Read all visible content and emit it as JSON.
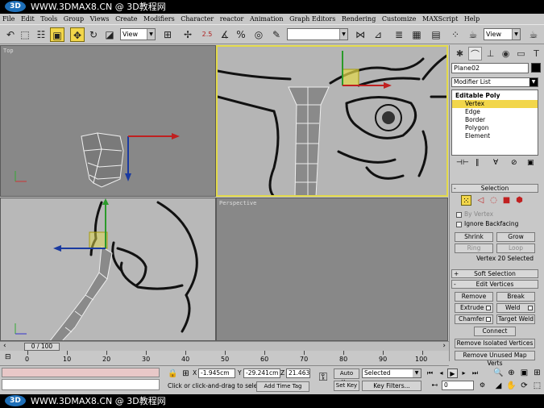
{
  "watermark": {
    "logo": "3D",
    "top_text": "WWW.3DMAX8.CN @ 3D教程网",
    "bottom_text": "WWW.3DMAX8.CN @ 3D教程网"
  },
  "menu": [
    "File",
    "Edit",
    "Tools",
    "Group",
    "Views",
    "Create",
    "Modifiers",
    "Character",
    "reactor",
    "Animation",
    "Graph Editors",
    "Rendering",
    "Customize",
    "MAXScript",
    "Help"
  ],
  "toolbar": {
    "ref_coord": "View",
    "named_sel": "",
    "view_right": "View",
    "snap_label": "2.5"
  },
  "viewports": {
    "top": "Top",
    "front": "",
    "left": "",
    "perspective": "Perspective"
  },
  "command_panel": {
    "object_name": "Plane02",
    "modifier_list": "Modifier List",
    "stack": [
      "Editable Poly",
      "Vertex",
      "Edge",
      "Border",
      "Polygon",
      "Element"
    ],
    "selection": {
      "title": "Selection",
      "by_vertex": "By Vertex",
      "ignore_backfacing": "Ignore Backfacing",
      "shrink": "Shrink",
      "grow": "Grow",
      "ring": "Ring",
      "loop": "Loop",
      "status": "Vertex 20 Selected"
    },
    "soft_selection": "Soft Selection",
    "edit_vertices": {
      "title": "Edit Vertices",
      "remove": "Remove",
      "break": "Break",
      "extrude": "Extrude",
      "weld": "Weld",
      "chamfer": "Chamfer",
      "target_weld": "Target Weld",
      "connect": "Connect",
      "remove_isolated": "Remove Isolated Vertices",
      "remove_unused": "Remove Unused Map Verts"
    }
  },
  "timeslider": {
    "frame": "0 / 100",
    "ticks": [
      "0",
      "10",
      "20",
      "30",
      "40",
      "50",
      "60",
      "70",
      "80",
      "90",
      "100"
    ]
  },
  "statusbar": {
    "prompt": "Click or click-and-drag to select ob",
    "x_label": "X",
    "x": "-1.945cm",
    "y_label": "Y",
    "y": "-29.241cm",
    "z_label": "Z",
    "z": "21.463cm",
    "add_time_tag": "Add Time Tag",
    "auto_key": "Auto Key",
    "set_key": "Set Key",
    "selected": "Selected",
    "key_filters": "Key Filters...",
    "frame": "0"
  },
  "colors": {
    "active_yellow": "#f2d64a",
    "viewport_gray": "#888888",
    "front_bg": "#b5b5b5"
  }
}
